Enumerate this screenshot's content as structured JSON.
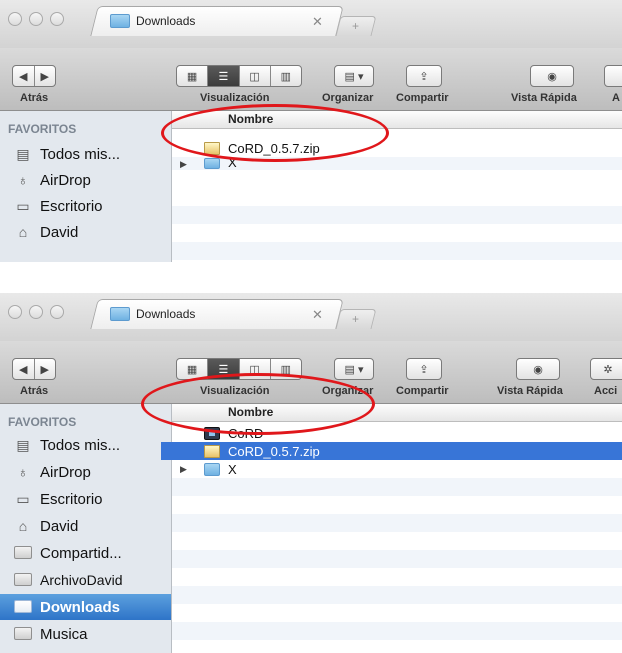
{
  "panels": [
    {
      "tab_title": "Downloads",
      "toolbar": {
        "back_label": "Atrás",
        "view_label": "Visualización",
        "organize_label": "Organizar",
        "share_label": "Compartir",
        "quicklook_label": "Vista Rápida",
        "action_label": "A"
      },
      "sidebar": {
        "heading": "FAVORITOS",
        "items": [
          {
            "label": "Todos mis...",
            "icon": "all-files-icon"
          },
          {
            "label": "AirDrop",
            "icon": "airdrop-icon"
          },
          {
            "label": "Escritorio",
            "icon": "desktop-icon"
          },
          {
            "label": "David",
            "icon": "home-icon"
          }
        ]
      },
      "list": {
        "column_header": "Nombre",
        "rows": [
          {
            "name": "CoRD_0.5.7.zip",
            "icon": "zip-icon",
            "selected": false
          },
          {
            "name": "X",
            "icon": "folder-icon",
            "selected": false,
            "disclosure": "▶"
          }
        ]
      }
    },
    {
      "tab_title": "Downloads",
      "toolbar": {
        "back_label": "Atrás",
        "view_label": "Visualización",
        "organize_label": "Organizar",
        "share_label": "Compartir",
        "quicklook_label": "Vista Rápida",
        "action_label": "Acci"
      },
      "sidebar": {
        "heading": "FAVORITOS",
        "items": [
          {
            "label": "Todos mis...",
            "icon": "all-files-icon"
          },
          {
            "label": "AirDrop",
            "icon": "airdrop-icon"
          },
          {
            "label": "Escritorio",
            "icon": "desktop-icon"
          },
          {
            "label": "David",
            "icon": "home-icon"
          },
          {
            "label": "Compartid...",
            "icon": "folder-icon"
          },
          {
            "label": "ArchivoDavid",
            "icon": "folder-icon"
          },
          {
            "label": "Downloads",
            "icon": "downloads-folder-icon",
            "selected": true
          },
          {
            "label": "Musica",
            "icon": "folder-icon"
          }
        ]
      },
      "list": {
        "column_header": "Nombre",
        "rows": [
          {
            "name": "CoRD",
            "icon": "cord-app-icon",
            "selected": false
          },
          {
            "name": "CoRD_0.5.7.zip",
            "icon": "zip-icon",
            "selected": true
          },
          {
            "name": "X",
            "icon": "folder-icon",
            "selected": false,
            "disclosure": "▶"
          }
        ]
      }
    }
  ],
  "colors": {
    "highlight": "#e0171b",
    "selection": "#3875d7",
    "sidebar_bg": "#e3e8ee"
  }
}
